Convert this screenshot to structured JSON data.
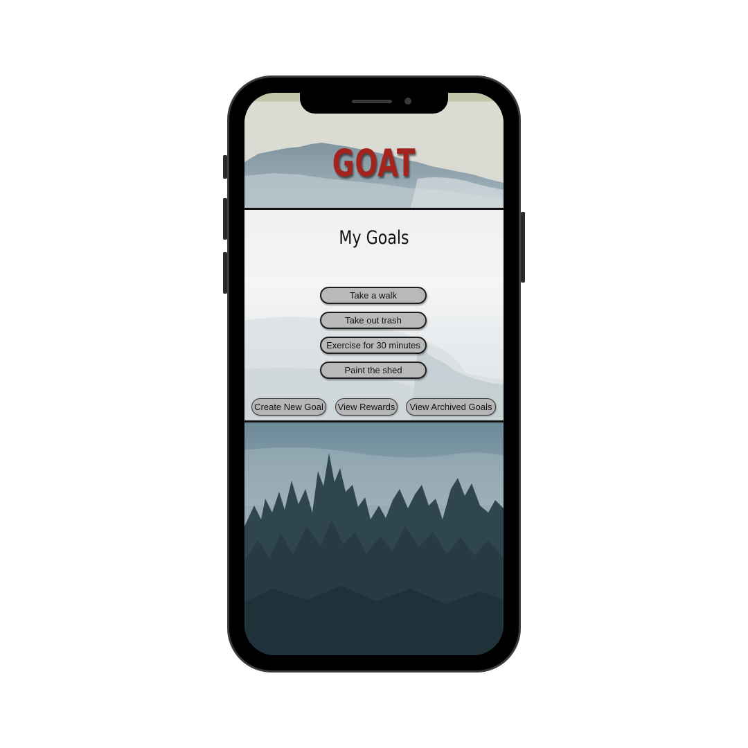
{
  "app": {
    "brand": "GOAT",
    "brand_color": "#a3231e"
  },
  "goals_screen": {
    "title": "My Goals",
    "goals": [
      {
        "label": "Take a walk"
      },
      {
        "label": "Take out trash"
      },
      {
        "label": "Exercise for 30 minutes"
      },
      {
        "label": "Paint the shed"
      }
    ],
    "actions": {
      "create": "Create New Goal",
      "rewards": "View Rewards",
      "archived": "View Archived Goals"
    }
  },
  "device": {
    "type": "phone mockup",
    "notch_icons": [
      "speaker-icon",
      "camera-icon"
    ]
  },
  "colors": {
    "button_fill": "#b9b9b9",
    "button_border": "#1c1c1c",
    "panel_border": "#111111"
  }
}
